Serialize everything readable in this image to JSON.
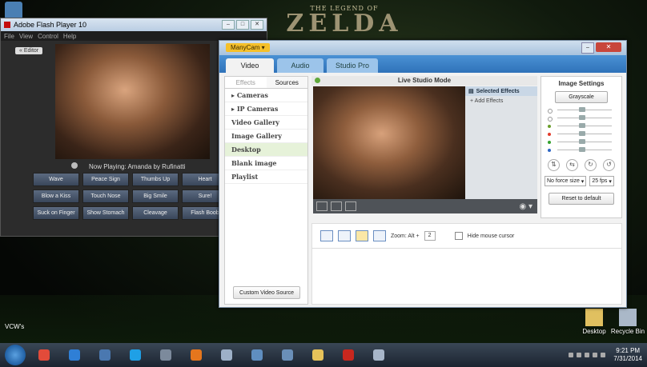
{
  "desktop": {
    "wallpaper_small": "THE LEGEND OF",
    "wallpaper_big": "ZELDA",
    "vcw_label": "VCW's",
    "icons": [
      {
        "label": "Desktop",
        "icon": "folder-icon"
      },
      {
        "label": "Recycle Bin",
        "icon": "recycle-bin-icon"
      }
    ]
  },
  "flash": {
    "title": "Adobe Flash Player 10",
    "menu": [
      "File",
      "View",
      "Control",
      "Help"
    ],
    "editor_label": "« Editor",
    "now_playing": "Now Playing: Amanda by Rufinatti",
    "buttons": [
      "Wave",
      "Peace Sign",
      "Thumbs Up",
      "Heart",
      "Blow a Kiss",
      "Touch Nose",
      "Big Smile",
      "Sure!",
      "Suck on Finger",
      "Show Stomach",
      "Cleavage",
      "Flash Boob"
    ]
  },
  "manycam": {
    "brand": "ManyCam ▾",
    "tabs": [
      "Video",
      "Audio",
      "Studio Pro"
    ],
    "left_tabs": [
      "Effects",
      "Sources"
    ],
    "sources": [
      "Cameras",
      "IP Cameras",
      "Video Gallery",
      "Image Gallery",
      "Desktop",
      "Blank image",
      "Playlist"
    ],
    "selected_source": "Desktop",
    "custom_source": "Custom Video Source",
    "live_studio": "Live Studio Mode",
    "selected_effects": "Selected Effects",
    "add_effects": "Add Effects",
    "image_settings": {
      "title": "Image Settings",
      "grayscale": "Grayscale",
      "force_size": "No force size",
      "fps": "25 fps",
      "reset": "Reset to default",
      "slider_colors": [
        "#ffffff",
        "#ffffff",
        "#6a9e2a",
        "#e23b2b",
        "#34a12e",
        "#2d66c4"
      ]
    },
    "zoom_label": "Zoom: Alt +",
    "zoom_value": "2",
    "hide_cursor": "Hide mouse cursor"
  },
  "taskbar": {
    "apps": [
      {
        "name": "chrome-app",
        "color": "#e24b3a"
      },
      {
        "name": "media-player-app",
        "color": "#2f7fd6"
      },
      {
        "name": "explorer-app",
        "color": "#4a78b0"
      },
      {
        "name": "skype-app",
        "color": "#1fa0e6"
      },
      {
        "name": "calculator-app",
        "color": "#7c8a9c"
      },
      {
        "name": "firefox-app",
        "color": "#e5761d"
      },
      {
        "name": "window-app",
        "color": "#9db0c8"
      },
      {
        "name": "disc-app",
        "color": "#5f8ec0"
      },
      {
        "name": "network-app",
        "color": "#6a8fb8"
      },
      {
        "name": "folder-app",
        "color": "#e6c25a"
      },
      {
        "name": "flash-app",
        "color": "#c8271e"
      },
      {
        "name": "control-app",
        "color": "#a7b6c9"
      }
    ],
    "time": "9:21 PM",
    "date": "7/31/2014"
  }
}
